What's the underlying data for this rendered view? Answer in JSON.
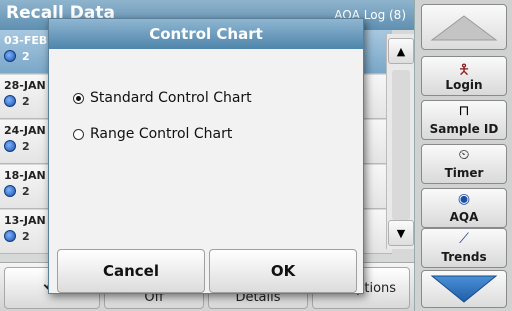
{
  "titlebar": {
    "title": "Recall Data",
    "right": "AQA Log (8)"
  },
  "rows": [
    {
      "date": "03-FEB",
      "num": "2"
    },
    {
      "date": "28-JAN",
      "num": "2"
    },
    {
      "date": "24-JAN",
      "num": "2"
    },
    {
      "date": "18-JAN",
      "num": "2"
    },
    {
      "date": "13-JAN",
      "num": "2"
    }
  ],
  "bottombar": {
    "b2": "Off",
    "b3": "Details",
    "b4": "Options"
  },
  "rightpanel": {
    "login": "Login",
    "sample": "Sample ID",
    "timer": "Timer",
    "aqa": "AQA",
    "trends": "Trends"
  },
  "dialog": {
    "title": "Control Chart",
    "option1": "Standard Control Chart",
    "option2": "Range Control Chart",
    "selected": "option1",
    "cancel": "Cancel",
    "ok": "OK"
  }
}
